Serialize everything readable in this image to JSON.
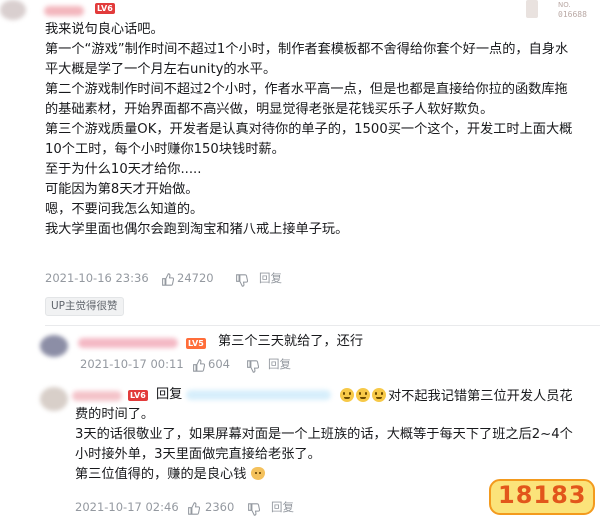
{
  "colors": {
    "level_badge": "#ff6d3a",
    "link_blue": "#00aeec",
    "meta_grey": "#9499a0"
  },
  "main_comment": {
    "level": "LV6",
    "lines": [
      "我来说句良心话吧。",
      "第一个“游戏”制作时间不超过1个小时，制作者套模板都不舍得给你套个好一点的，自身水",
      "平大概是学了一个月左右unity的水平。",
      "第二个游戏制作时间不超过2个小时，作者水平高一点，但是也都是直接给你拉的函数库拖",
      "的基础素材，开始界面都不高兴做，明显觉得老张是花钱买乐子人软好欺负。",
      "第三个游戏质量OK，开发者是认真对待你的单子的，1500买一个这个，开发工时上面大概",
      "10个工时，每个小时赚你150块钱时薪。",
      "至于为什么10天才给你.....",
      "可能因为第8天才开始做。",
      "嗯，不要问我怎么知道的。",
      "我大学里面也偶尔会跑到淘宝和猪八戒上接单子玩。"
    ],
    "timestamp": "2021-10-16 23:36",
    "likes": "24720",
    "reply_label": "回复",
    "up_tag": "UP主觉得很赞"
  },
  "corner_badge": {
    "label": "NO.",
    "number": "016688"
  },
  "reply1": {
    "level": "LV5",
    "text": "第三个三天就给了，还行",
    "timestamp": "2021-10-17 00:11",
    "likes": "604",
    "reply_label": "回复"
  },
  "reply2": {
    "level": "LV6",
    "reply_prefix": "回复",
    "first_line_tail": "对不起我记错第三位开发人员花",
    "lines": [
      "费的时间了。",
      "3天的话很敬业了，如果屏幕对面是一个上班族的话，大概等于每天下了班之后2~4个",
      "小时接外单，3天里面做完直接给老张了。",
      "第三位值得的，赚的是良心钱"
    ],
    "timestamp": "2021-10-17 02:46",
    "likes": "2360",
    "reply_label": "回复"
  },
  "watermark": {
    "text": "18183"
  }
}
